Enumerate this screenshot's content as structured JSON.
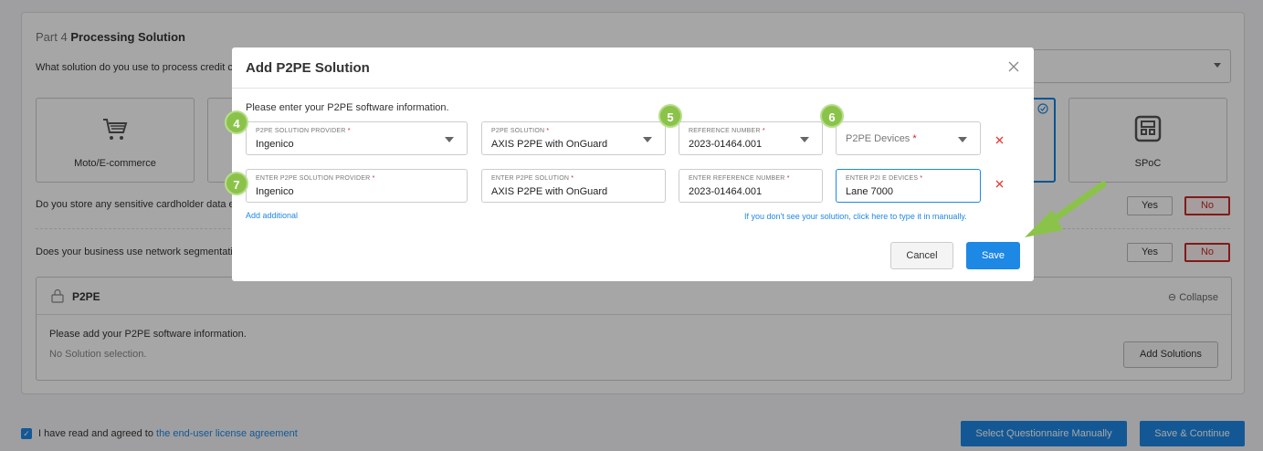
{
  "background": {
    "part_number": "Part 4",
    "part_title": "Processing Solution",
    "question_solution": "What solution do you use to process credit ca",
    "options": [
      {
        "label": "Moto/E-commerce",
        "icon": "cart-icon"
      },
      {
        "label": "SPoC",
        "icon": "terminal-icon"
      }
    ],
    "question_sensitive": "Do you store any sensitive cardholder data el",
    "question_segmentation": "Does your business use network segmentatio",
    "yes_label": "Yes",
    "no_label": "No",
    "p2pe_title": "P2PE",
    "collapse_label": "Collapse",
    "p2pe_prompt": "Please add your P2PE software information.",
    "p2pe_empty": "No Solution selection.",
    "add_solutions_label": "Add Solutions",
    "license_prefix": "I have read and agreed to ",
    "license_link": "the end-user license agreement",
    "select_manual_label": "Select Questionnaire Manually",
    "save_continue_label": "Save & Continue"
  },
  "modal": {
    "title": "Add P2PE Solution",
    "intro": "Please enter your P2PE software information.",
    "row1": {
      "provider": {
        "label": "P2PE SOLUTION PROVIDER",
        "required": "*",
        "value": "Ingenico"
      },
      "solution": {
        "label": "P2PE SOLUTION",
        "required": "*",
        "value": "AXIS P2PE with OnGuard"
      },
      "reference": {
        "label": "REFERENCE NUMBER",
        "required": "*",
        "value": "2023-01464.001"
      },
      "devices": {
        "placeholder": "P2PE Devices",
        "required": "*"
      }
    },
    "row2": {
      "provider": {
        "label": "ENTER P2PE SOLUTION PROVIDER",
        "required": "*",
        "value": "Ingenico"
      },
      "solution": {
        "label": "ENTER P2PE SOLUTION",
        "required": "*",
        "value": "AXIS P2PE with OnGuard"
      },
      "reference": {
        "label": "ENTER REFERENCE NUMBER",
        "required": "*",
        "value": "2023-01464.001"
      },
      "devices": {
        "label": "ENTER P2I E DEVICES",
        "required": "*",
        "value": "Lane 7000"
      }
    },
    "add_additional": "Add additional",
    "manual_hint": "If you don't see your solution, click here to type it in manually.",
    "cancel_label": "Cancel",
    "save_label": "Save"
  },
  "badges": [
    "4",
    "5",
    "6",
    "7"
  ],
  "colors": {
    "accent": "#1e88e5",
    "badge": "#8bc34a",
    "danger": "#c62828"
  }
}
